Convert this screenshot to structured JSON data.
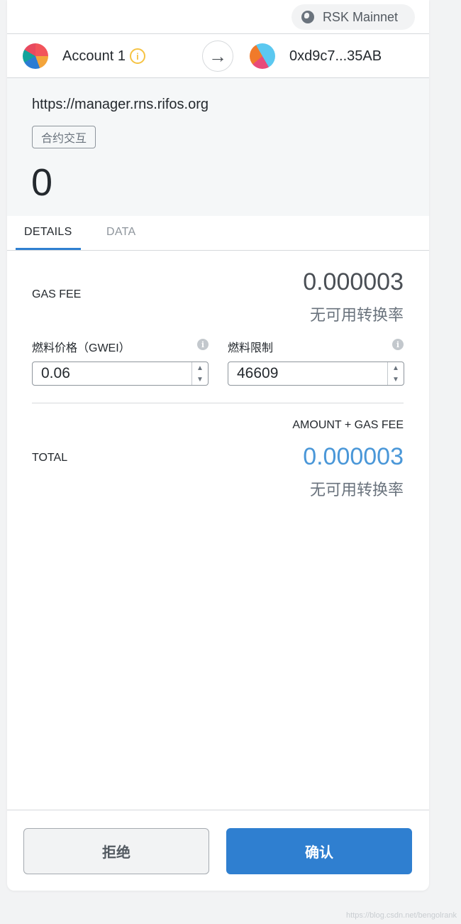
{
  "network": {
    "name": "RSK Mainnet",
    "icon": "globe-icon"
  },
  "sender": {
    "name": "Account 1",
    "info_icon": "info-icon"
  },
  "recipient": {
    "address": "0xd9c7...35AB"
  },
  "transfer_arrow": "→",
  "summary": {
    "origin": "https://manager.rns.rifos.org",
    "action": "合约交互",
    "amount": "0"
  },
  "tabs": {
    "details": "DETAILS",
    "data": "DATA"
  },
  "gas": {
    "label": "GAS FEE",
    "value": "0.000003",
    "fiat": "无可用转换率",
    "price_label": "燃料价格（GWEI）",
    "price_value": "0.06",
    "limit_label": "燃料限制",
    "limit_value": "46609",
    "info_glyph": "i"
  },
  "total": {
    "sublabel": "AMOUNT + GAS FEE",
    "label": "TOTAL",
    "value": "0.000003",
    "fiat": "无可用转换率"
  },
  "buttons": {
    "reject": "拒绝",
    "confirm": "确认"
  },
  "stepper": {
    "up": "▲",
    "down": "▼"
  },
  "watermark": "https://blog.csdn.net/bengolrank",
  "colors": {
    "primary": "#2f7fd0",
    "total_value": "#4a97d8",
    "warning": "#f6c343"
  }
}
